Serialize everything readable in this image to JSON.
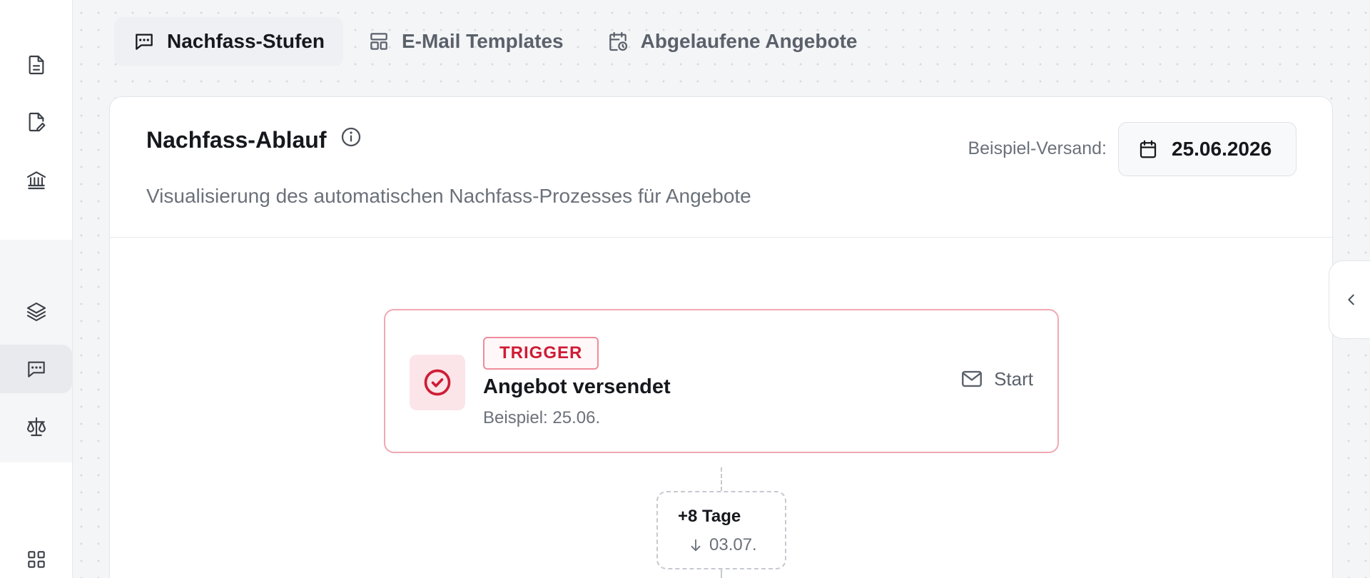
{
  "sidebar": {
    "icons": [
      "document-icon",
      "document-edit-icon",
      "bank-icon",
      "layers-icon",
      "message-square-icon",
      "scale-icon",
      "grid-icon"
    ],
    "active": "message-square-icon"
  },
  "tabs": [
    {
      "label": "Nachfass-Stufen",
      "icon": "message-square-icon",
      "active": true
    },
    {
      "label": "E-Mail Templates",
      "icon": "layout-template-icon",
      "active": false
    },
    {
      "label": "Abgelaufene Angebote",
      "icon": "calendar-clock-icon",
      "active": false
    }
  ],
  "card": {
    "title": "Nachfass-Ablauf",
    "subtitle": "Visualisierung des automatischen Nachfass-Prozesses für Angebote",
    "send_label": "Beispiel-Versand:",
    "send_date": "25.06.2026"
  },
  "trigger": {
    "badge": "TRIGGER",
    "title": "Angebot versendet",
    "subtitle": "Beispiel: 25.06.",
    "action": "Start"
  },
  "delay": {
    "title": "+8 Tage",
    "date": "03.07."
  },
  "colors": {
    "accent_red": "#cf1c35",
    "trigger_border": "#f1a8b3",
    "badge_bg": "#fbe5e8"
  }
}
